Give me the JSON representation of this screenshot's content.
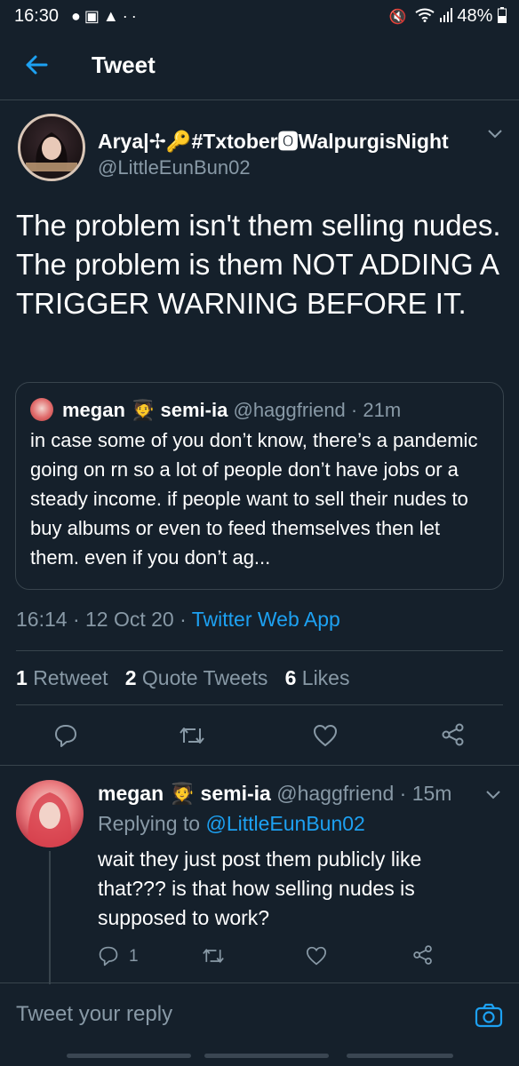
{
  "status_bar": {
    "time": "16:30",
    "battery": "48%",
    "left_icons": [
      "chat-bubble-icon",
      "bag-icon",
      "alert-icon",
      "more-icon"
    ],
    "right_icons": [
      "mute-icon",
      "wifi-icon",
      "signal-icon",
      "battery-icon"
    ]
  },
  "header": {
    "title": "Tweet"
  },
  "tweet": {
    "author_name": "Arya|✢🔑#Txtober🅾WalpurgisNight",
    "author_handle": "@LittleEunBun02",
    "text": "The problem isn't them selling nudes. The problem is them NOT ADDING A TRIGGER WARNING BEFORE IT.",
    "timestamp": "16:14 · 12 Oct 20 · ",
    "source": "Twitter Web App",
    "stats": {
      "retweets_count": "1",
      "retweets_label": "Retweet",
      "quotes_count": "2",
      "quotes_label": "Quote Tweets",
      "likes_count": "6",
      "likes_label": "Likes"
    }
  },
  "quoted_tweet": {
    "author_name": "megan 🧑‍🎓 semi-ia",
    "author_handle": "@haggfriend",
    "time": "· 21m",
    "text": "in case some of you don’t know, there’s a pandemic going on rn so a lot of people don’t have jobs or a steady income. if people want to sell their nudes to buy albums or even to feed themselves then let them. even if you don’t ag..."
  },
  "reply": {
    "author_name": "megan 🧑‍🎓 semi-ia",
    "author_handle": "@haggfriend",
    "time": "· 15m",
    "replying_to_label": "Replying to",
    "replying_to_handle": "@LittleEunBun02",
    "text": "wait they just post them publicly like that??? is that how selling nudes is supposed to work?",
    "reply_count": "1"
  },
  "composer": {
    "placeholder": "Tweet your reply"
  },
  "colors": {
    "background": "#15202b",
    "accent": "#1da1f2",
    "muted": "#8899a6",
    "divider": "#38444d"
  }
}
